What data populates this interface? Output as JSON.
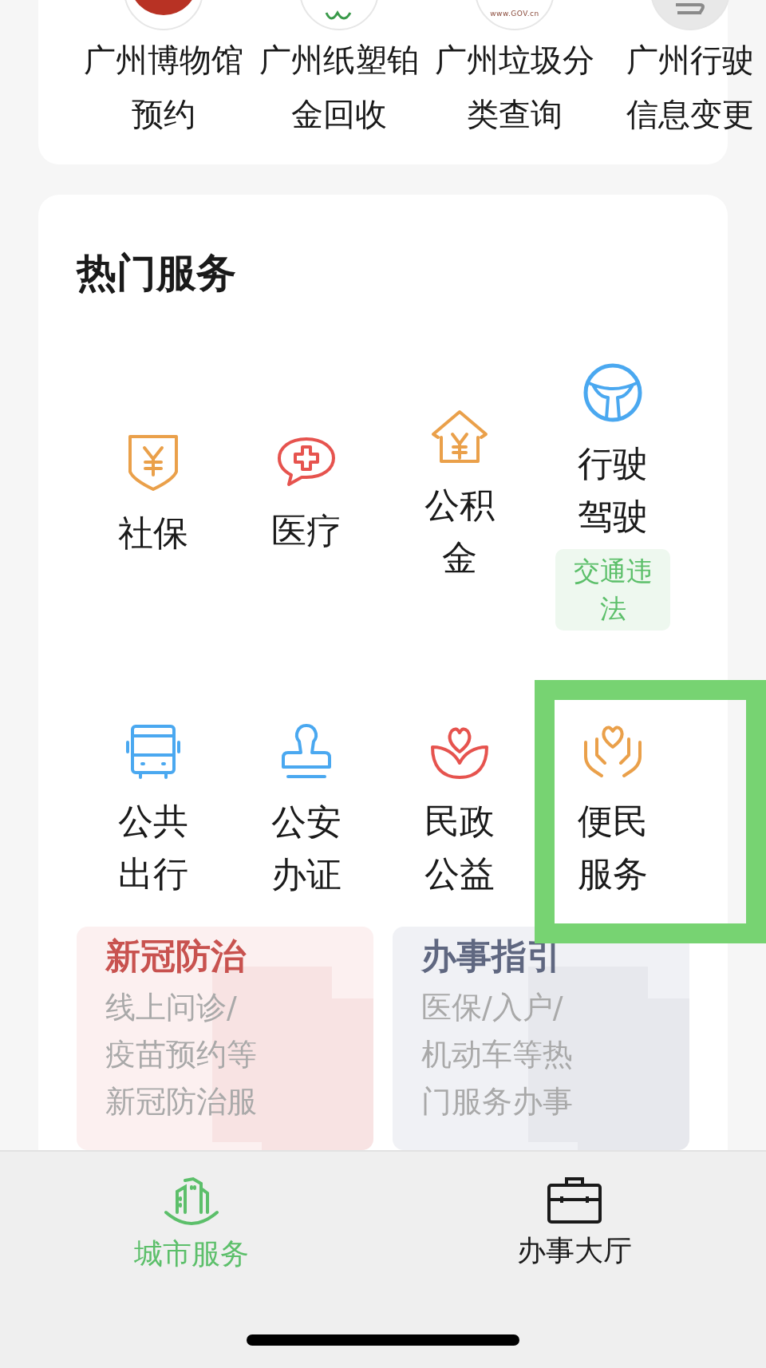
{
  "quick_apps": [
    {
      "kind": "red",
      "lines": [
        "广州博物馆",
        "预约"
      ]
    },
    {
      "kind": "green",
      "lines": [
        "广州纸塑铂",
        "金回收"
      ]
    },
    {
      "kind": "gov",
      "logo_text": "www.GOV.cn",
      "lines": [
        "广州垃圾分",
        "类查询"
      ]
    },
    {
      "kind": "grey",
      "lines": [
        "广州行驶",
        "信息变更"
      ]
    }
  ],
  "hot_services": {
    "title": "热门服务",
    "items": [
      {
        "label": "社保",
        "highlighted": false
      },
      {
        "label": "医疗",
        "highlighted": false
      },
      {
        "label": "公积金",
        "highlighted": false
      },
      {
        "label": "行驶驾驶",
        "badge": "交通违法",
        "highlighted": false
      },
      {
        "label": "公共出行",
        "highlighted": false
      },
      {
        "label": "公安办证",
        "highlighted": false
      },
      {
        "label": "民政公益",
        "highlighted": false
      },
      {
        "label": "便民服务",
        "highlighted": true
      }
    ],
    "promos": [
      {
        "kind": "red",
        "title": "新冠防治",
        "lines": [
          "线上问诊/",
          "疫苗预约等",
          "新冠防治服"
        ]
      },
      {
        "kind": "blue",
        "title": "办事指引",
        "lines": [
          "医保/入户/",
          "机动车等热",
          "门服务办事"
        ]
      }
    ]
  },
  "tab_bar": [
    {
      "label": "城市服务",
      "selected": true
    },
    {
      "label": "办事大厅",
      "selected": false
    }
  ]
}
